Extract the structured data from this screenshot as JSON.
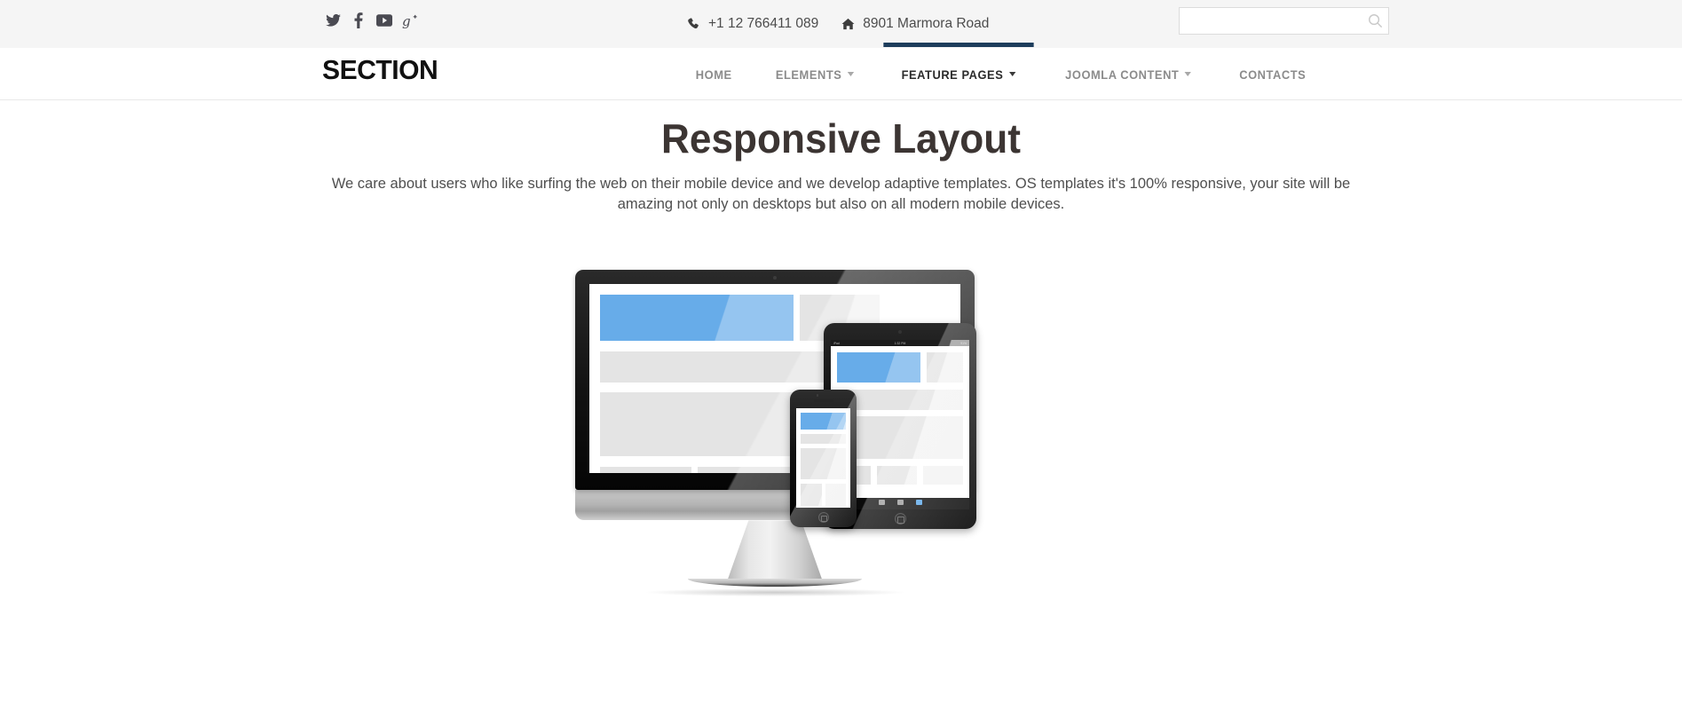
{
  "topbar": {
    "social": [
      {
        "name": "twitter",
        "label": "Twitter"
      },
      {
        "name": "facebook",
        "label": "Facebook"
      },
      {
        "name": "youtube",
        "label": "YouTube"
      },
      {
        "name": "googleplus",
        "label": "Google Plus"
      }
    ],
    "phone": "+1 12 766411 089",
    "address": "8901 Marmora Road",
    "search": {
      "value": "",
      "placeholder": "",
      "icon": "search-icon"
    }
  },
  "header": {
    "logo": "SECTION",
    "nav": [
      {
        "label": "HOME",
        "caret": false,
        "active": false
      },
      {
        "label": "ELEMENTS",
        "caret": true,
        "active": false
      },
      {
        "label": "FEATURE PAGES",
        "caret": true,
        "active": true
      },
      {
        "label": "JOOMLA CONTENT",
        "caret": true,
        "active": false
      },
      {
        "label": "CONTACTS",
        "caret": false,
        "active": false
      }
    ]
  },
  "main": {
    "title": "Responsive Layout",
    "intro": "We care about users who like surfing the web on their mobile device and we develop adaptive templates. OS templates it's 100% responsive, your site will be amazing not only on desktops but also on all modern mobile devices."
  },
  "devices": {
    "desktop_alt": "Desktop monitor showing responsive website wireframe",
    "tablet_alt": "Tablet showing responsive website wireframe",
    "phone_alt": "Smartphone showing responsive website wireframe",
    "tablet_status_left": "iPad",
    "tablet_status_center": "1:32 PM",
    "tablet_status_right": "91%"
  },
  "colors": {
    "accent_blue": "#67ace9",
    "active_nav_bar": "#1d3d5c",
    "topbar_bg": "#f5f5f5",
    "wireframe_grey": "#e4e4e4",
    "heading": "#3c3533"
  }
}
